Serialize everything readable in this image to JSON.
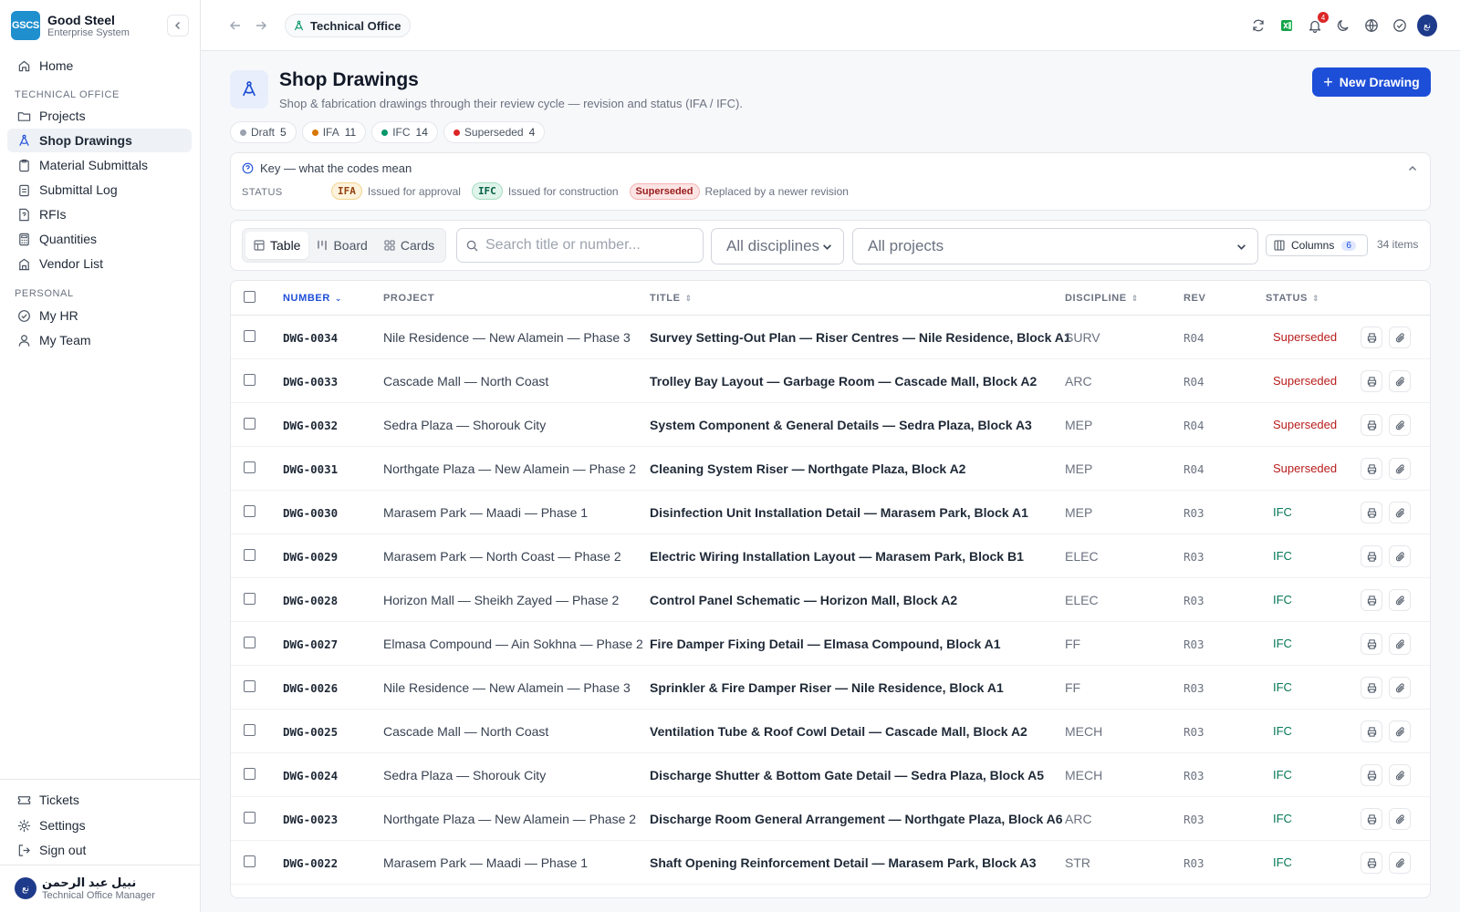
{
  "brand": {
    "logo": "GSCS",
    "name": "Good Steel",
    "subtitle": "Enterprise System"
  },
  "sidebar": {
    "home": "Home",
    "section_technical": "TECHNICAL OFFICE",
    "technical_items": [
      "Projects",
      "Shop Drawings",
      "Material Submittals",
      "Submittal Log",
      "RFIs",
      "Quantities",
      "Vendor List"
    ],
    "section_personal": "PERSONAL",
    "personal_items": [
      "My HR",
      "My Team"
    ],
    "bottom_items": [
      "Tickets",
      "Settings",
      "Sign out"
    ],
    "user": {
      "initials": "نع",
      "name": "نبيل عبد الرحمن",
      "role": "Technical Office Manager"
    }
  },
  "topbar": {
    "breadcrumb": "Technical Office",
    "notifications_count": "4",
    "avatar_initials": "نع"
  },
  "page": {
    "title": "Shop Drawings",
    "subtitle": "Shop & fabrication drawings through their review cycle — revision and status (IFA / IFC).",
    "new_button": "New Drawing"
  },
  "status_chips": [
    {
      "label": "Draft",
      "count": "5",
      "color": "#9ca3af"
    },
    {
      "label": "IFA",
      "count": "11",
      "color": "#d97706"
    },
    {
      "label": "IFC",
      "count": "14",
      "color": "#059669"
    },
    {
      "label": "Superseded",
      "count": "4",
      "color": "#dc2626"
    }
  ],
  "key": {
    "heading": "Key — what the codes mean",
    "status_label": "STATUS",
    "ifa_code": "IFA",
    "ifa_desc": "Issued for approval",
    "ifc_code": "IFC",
    "ifc_desc": "Issued for construction",
    "sup_code": "Superseded",
    "sup_desc": "Replaced by a newer revision"
  },
  "toolbar": {
    "views": [
      "Table",
      "Board",
      "Cards"
    ],
    "search_placeholder": "Search title or number...",
    "discipline_select": "All disciplines",
    "project_select": "All projects",
    "columns_label": "Columns",
    "columns_count": "6",
    "item_count": "34 items"
  },
  "table": {
    "headers": {
      "number": "NUMBER",
      "project": "PROJECT",
      "title": "TITLE",
      "discipline": "DISCIPLINE",
      "rev": "REV",
      "status": "STATUS"
    },
    "rows": [
      {
        "number": "DWG-0034",
        "project": "Nile Residence — New Alamein — Phase 3",
        "title": "Survey Setting-Out Plan — Riser Centres — Nile Residence, Block A1",
        "discipline": "SURV",
        "rev": "R04",
        "status": "Superseded"
      },
      {
        "number": "DWG-0033",
        "project": "Cascade Mall — North Coast",
        "title": "Trolley Bay Layout — Garbage Room — Cascade Mall, Block A2",
        "discipline": "ARC",
        "rev": "R04",
        "status": "Superseded"
      },
      {
        "number": "DWG-0032",
        "project": "Sedra Plaza — Shorouk City",
        "title": "System Component & General Details — Sedra Plaza, Block A3",
        "discipline": "MEP",
        "rev": "R04",
        "status": "Superseded"
      },
      {
        "number": "DWG-0031",
        "project": "Northgate Plaza — New Alamein — Phase 2",
        "title": "Cleaning System Riser — Northgate Plaza, Block A2",
        "discipline": "MEP",
        "rev": "R04",
        "status": "Superseded"
      },
      {
        "number": "DWG-0030",
        "project": "Marasem Park — Maadi — Phase 1",
        "title": "Disinfection Unit Installation Detail — Marasem Park, Block A1",
        "discipline": "MEP",
        "rev": "R03",
        "status": "IFC"
      },
      {
        "number": "DWG-0029",
        "project": "Marasem Park — North Coast — Phase 2",
        "title": "Electric Wiring Installation Layout — Marasem Park, Block B1",
        "discipline": "ELEC",
        "rev": "R03",
        "status": "IFC"
      },
      {
        "number": "DWG-0028",
        "project": "Horizon Mall — Sheikh Zayed — Phase 2",
        "title": "Control Panel Schematic — Horizon Mall, Block A2",
        "discipline": "ELEC",
        "rev": "R03",
        "status": "IFC"
      },
      {
        "number": "DWG-0027",
        "project": "Elmasa Compound — Ain Sokhna — Phase 2",
        "title": "Fire Damper Fixing Detail — Elmasa Compound, Block A1",
        "discipline": "FF",
        "rev": "R03",
        "status": "IFC"
      },
      {
        "number": "DWG-0026",
        "project": "Nile Residence — New Alamein — Phase 3",
        "title": "Sprinkler & Fire Damper Riser — Nile Residence, Block A1",
        "discipline": "FF",
        "rev": "R03",
        "status": "IFC"
      },
      {
        "number": "DWG-0025",
        "project": "Cascade Mall — North Coast",
        "title": "Ventilation Tube & Roof Cowl Detail — Cascade Mall, Block A2",
        "discipline": "MECH",
        "rev": "R03",
        "status": "IFC"
      },
      {
        "number": "DWG-0024",
        "project": "Sedra Plaza — Shorouk City",
        "title": "Discharge Shutter & Bottom Gate Detail — Sedra Plaza, Block A5",
        "discipline": "MECH",
        "rev": "R03",
        "status": "IFC"
      },
      {
        "number": "DWG-0023",
        "project": "Northgate Plaza — New Alamein — Phase 2",
        "title": "Discharge Room General Arrangement — Northgate Plaza, Block A6",
        "discipline": "ARC",
        "rev": "R03",
        "status": "IFC"
      },
      {
        "number": "DWG-0022",
        "project": "Marasem Park — Maadi — Phase 1",
        "title": "Shaft Opening Reinforcement Detail — Marasem Park, Block A3",
        "discipline": "STR",
        "rev": "R03",
        "status": "IFC"
      }
    ]
  }
}
